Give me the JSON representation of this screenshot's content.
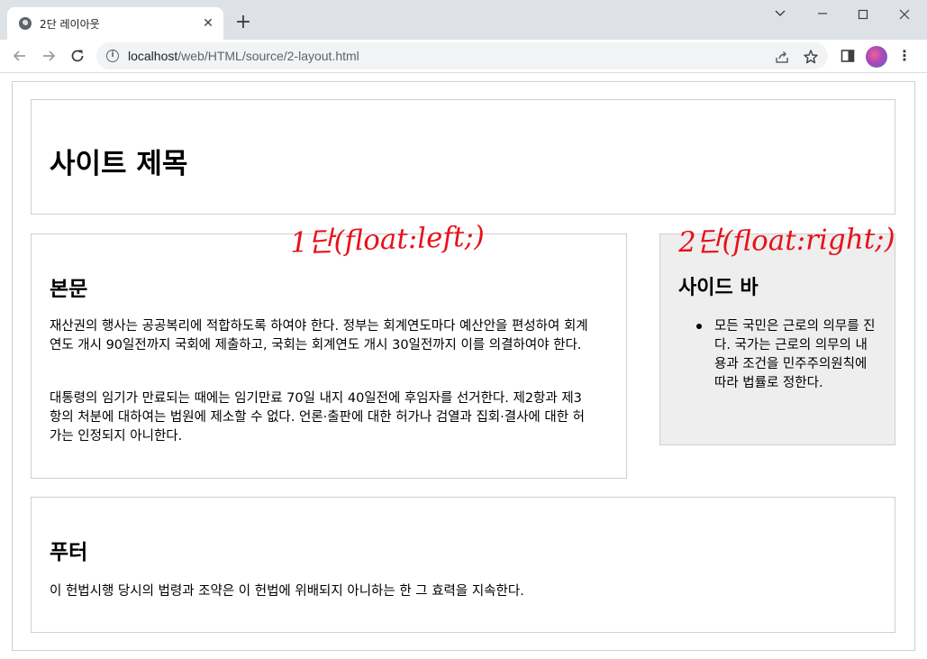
{
  "browser": {
    "tab_title": "2단 레이아웃",
    "url_host": "localhost",
    "url_path": "/web/HTML/source/2-layout.html"
  },
  "page": {
    "header_title": "사이트 제목",
    "main": {
      "heading": "본문",
      "paragraphs": [
        "재산권의 행사는 공공복리에 적합하도록 하여야 한다. 정부는 회계연도마다 예산안을 편성하여 회계연도 개시 90일전까지 국회에 제출하고, 국회는 회계연도 개시 30일전까지 이를 의결하여야 한다.",
        "대통령의 임기가 만료되는 때에는 임기만료 70일 내지 40일전에 후임자를 선거한다. 제2항과 제3항의 처분에 대하여는 법원에 제소할 수 없다. 언론·출판에 대한 허가나 검열과 집회·결사에 대한 허가는 인정되지 아니한다."
      ]
    },
    "sidebar": {
      "heading": "사이드 바",
      "items": [
        "모든 국민은 근로의 의무를 진다. 국가는 근로의 의무의 내용과 조건을 민주주의원칙에 따라 법률로 정한다."
      ]
    },
    "footer": {
      "heading": "푸터",
      "text": "이 헌법시행 당시의 법령과 조약은 이 헌법에 위배되지 아니하는 한 그 효력을 지속한다."
    }
  },
  "annotations": {
    "main_note": "1단(float:left;)",
    "side_note": "2단(float:right;)"
  },
  "colors": {
    "annotation": "#e8111b",
    "sidebar_bg": "#eeeeee",
    "border": "#cfcfcf"
  }
}
